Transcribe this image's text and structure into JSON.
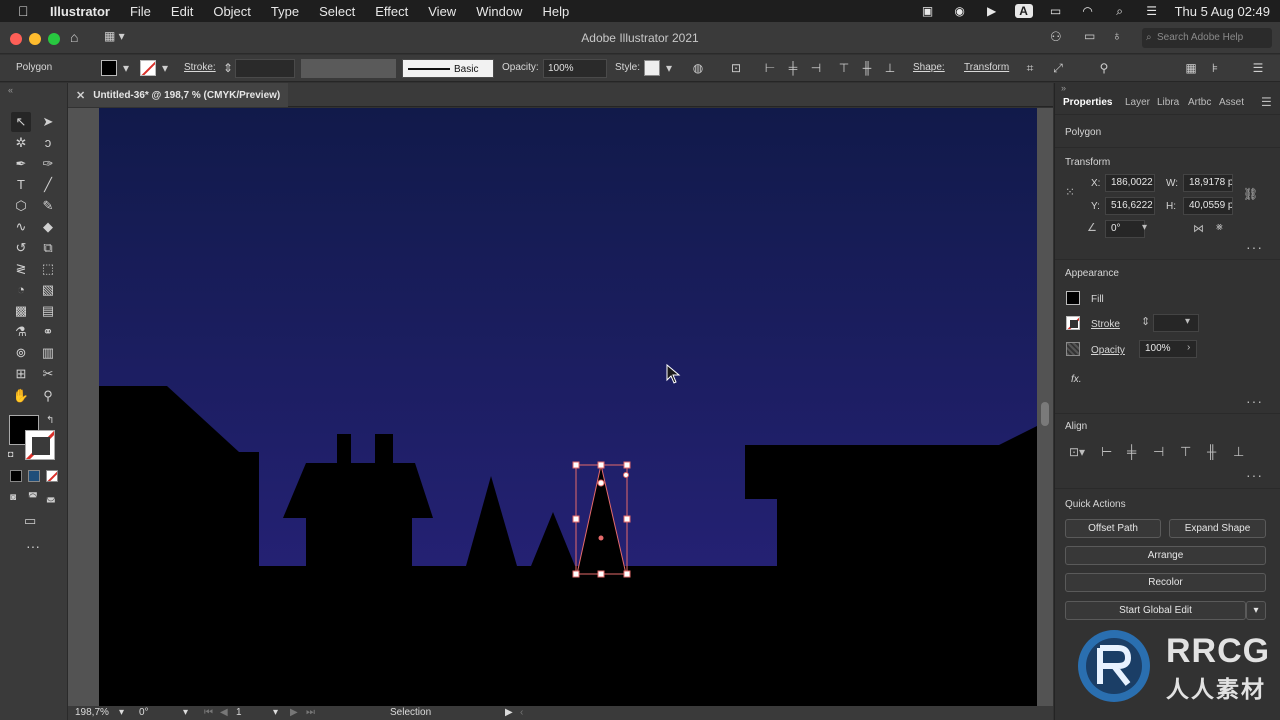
{
  "menubar": {
    "app_name": "Illustrator",
    "items": [
      "File",
      "Edit",
      "Object",
      "Type",
      "Select",
      "Effect",
      "View",
      "Window",
      "Help"
    ],
    "clock": "Thu 5 Aug  02:49",
    "status_icons": [
      "screen-record-icon",
      "accessibility-icon",
      "play-icon",
      "keyboard-a-icon",
      "battery-icon",
      "wifi-icon",
      "spotlight-search-icon",
      "control-center-icon"
    ]
  },
  "titlebar": {
    "title": "Adobe Illustrator 2021",
    "search_placeholder": "Search Adobe Help"
  },
  "controlbar": {
    "selection_type": "Polygon",
    "stroke_label": "Stroke:",
    "brush_label": "Basic",
    "opacity_label": "Opacity:",
    "opacity_value": "100%",
    "style_label": "Style:",
    "shape_label": "Shape:",
    "transform_label": "Transform"
  },
  "document_tab": {
    "title": "Untitled-36* @ 198,7 % (CMYK/Preview)"
  },
  "panel": {
    "tabs": [
      "Properties",
      "Layer",
      "Libra",
      "Artbc",
      "Asset"
    ],
    "object_type": "Polygon",
    "transform": {
      "section_title": "Transform",
      "x_label": "X:",
      "x_value": "186,0022",
      "y_label": "Y:",
      "y_value": "516,6222",
      "w_label": "W:",
      "w_value": "18,9178 p",
      "h_label": "H:",
      "h_value": "40,0559 p",
      "angle_value": "0°"
    },
    "appearance": {
      "section_title": "Appearance",
      "fill_label": "Fill",
      "stroke_label": "Stroke",
      "opacity_label": "Opacity",
      "opacity_value": "100%",
      "fx_label": "fx."
    },
    "align": {
      "section_title": "Align"
    },
    "quick_actions": {
      "section_title": "Quick Actions",
      "offset_path": "Offset Path",
      "expand_shape": "Expand Shape",
      "arrange": "Arrange",
      "recolor": "Recolor",
      "start_global_edit": "Start Global Edit"
    }
  },
  "statusbar": {
    "zoom": "198,7%",
    "rotation": "0°",
    "artboard_number": "1",
    "tool_name": "Selection"
  },
  "colors": {
    "sky_top": "#111a4a",
    "sky_bottom": "#2a2380",
    "silhouette": "#000000",
    "selection": "#e46a6a",
    "accent_red": "#d9302a"
  },
  "watermark": {
    "text_latin": "RRCG",
    "text_cjk": "人人素材"
  }
}
